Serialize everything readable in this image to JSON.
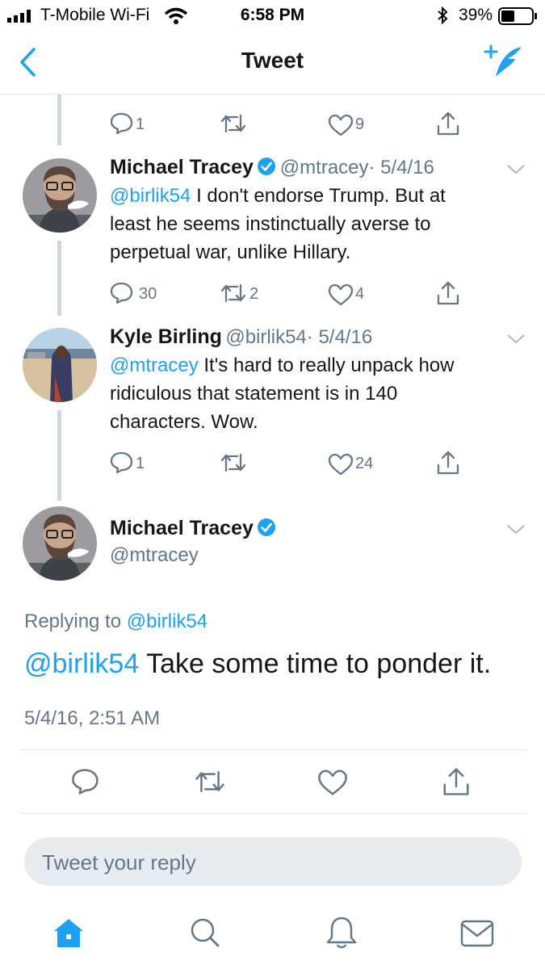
{
  "status_bar": {
    "carrier": "T-Mobile Wi-Fi",
    "time": "6:58 PM",
    "battery": "39%"
  },
  "nav": {
    "title": "Tweet"
  },
  "tweet0": {
    "reply_count": "1",
    "retweet_count": "",
    "like_count": "9"
  },
  "tweet1": {
    "name": "Michael Tracey",
    "handle": "@mtracey",
    "date": "· 5/4/16",
    "mention": "@birlik54",
    "line1": " I don't endorse Trump. But at",
    "line2": "least he seems instinctually averse to",
    "line3": "perpetual war, unlike Hillary.",
    "reply_count": "30",
    "retweet_count": "2",
    "like_count": "4"
  },
  "tweet2": {
    "name": "Kyle Birling",
    "handle": "@birlik54",
    "date": "· 5/4/16",
    "mention": "@mtracey",
    "line1": " It's hard to really unpack how",
    "line2": "ridiculous that statement is in 140",
    "line3": "characters. Wow.",
    "reply_count": "1",
    "retweet_count": "",
    "like_count": "24"
  },
  "main_tweet": {
    "name": "Michael Tracey",
    "handle": "@mtracey",
    "replying_prefix": "Replying to ",
    "replying_to": "@birlik54",
    "mention": "@birlik54",
    "text": " Take some time to ponder it.",
    "timestamp": "5/4/16, 2:51 AM"
  },
  "reply": {
    "placeholder": "Tweet your reply"
  },
  "colors": {
    "accent": "#1da1f2",
    "secondary_text": "#657786",
    "divider": "#e1e8ed"
  },
  "icons": [
    "back-chevron-icon",
    "compose-tweet-icon",
    "reply-icon",
    "retweet-icon",
    "like-icon",
    "share-icon",
    "caret-down-icon",
    "verified-badge-icon",
    "home-icon",
    "search-icon",
    "notifications-icon",
    "messages-icon"
  ]
}
